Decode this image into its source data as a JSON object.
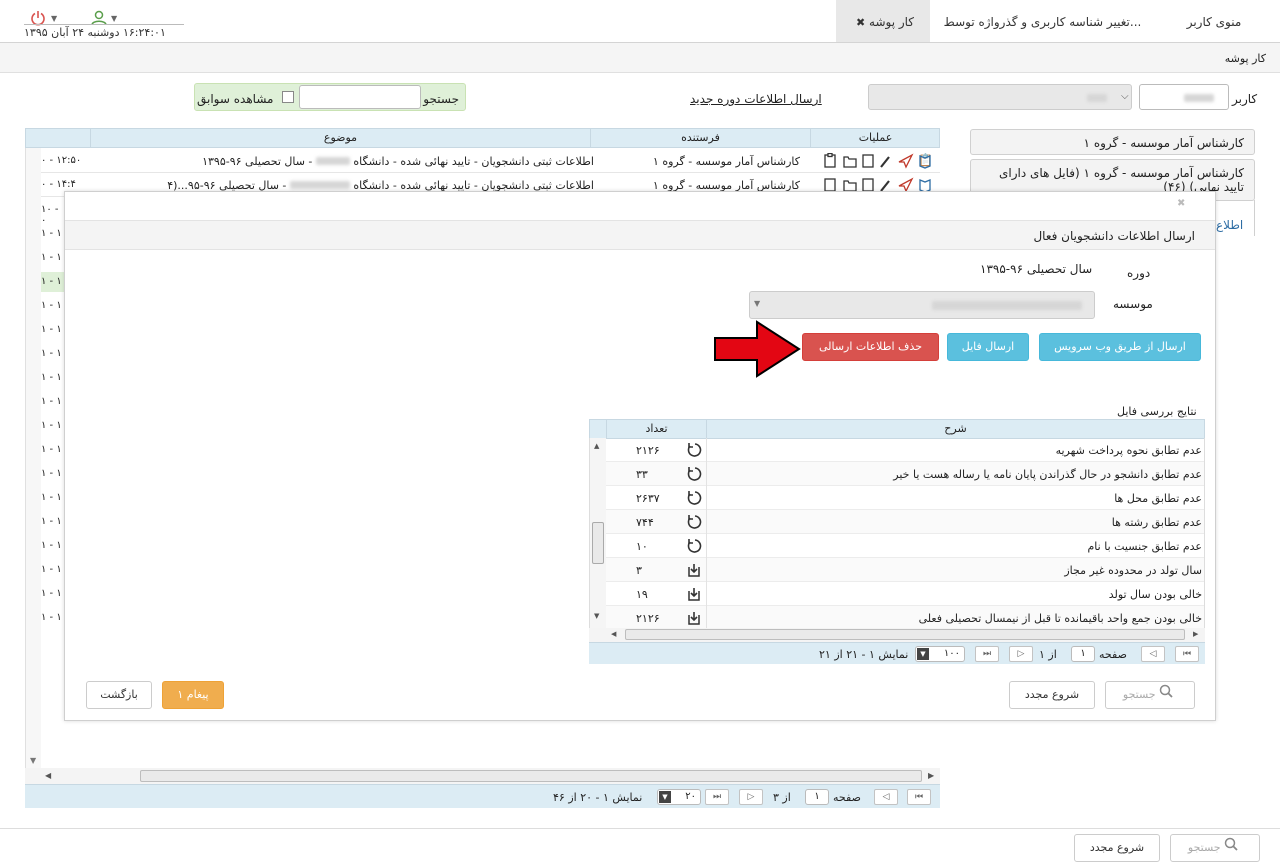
{
  "topbar": {
    "tabs": [
      {
        "label": "کار پوشه",
        "active": true
      },
      {
        "label": "تغییر شناسه کاربری و گذرواژه توسط..."
      },
      {
        "label": "منوی کاربر"
      }
    ],
    "datetime": "۱۶:۲۴:۰۱ دوشنبه ۲۴ آبان ۱۳۹۵"
  },
  "breadcrumb": "کار پوشه",
  "toolbar": {
    "user_label": "کاربر",
    "send_link": "ارسال اطلاعات دوره جدید",
    "search_label": "جستجو",
    "history_label": "مشاهده سوابق"
  },
  "grid": {
    "columns": [
      "عملیات",
      "فرستنده",
      "موضوع"
    ],
    "rows": [
      {
        "sender": "کارشناس آمار موسسه - گروه ۱",
        "subject_start": "اطلاعات ثبتی دانشجویان - تایید نهائی شده - دانشگاه",
        "subject_end": "- سال تحصیلی ۹۶-۱۳۹۵",
        "time": "۱۲:۵۰ - ۰"
      },
      {
        "sender": "کارشناس آمار موسسه - گروه ۱",
        "subject_start": "اطلاعات ثبتی دانشجویان - تایید نهائی شده - دانشگاه",
        "subject_end": "- سال تحصیلی ۹۶-۹۵...(۴",
        "time": "۱۴:۴ - ۰"
      }
    ],
    "left_times": [
      "۱۰ - ۰",
      "۱ - ۱",
      "۱ - ۱",
      "۱ - ۱",
      "۱ - ۱",
      "۱ - ۱",
      "۱ - ۱",
      "۱ - ۱",
      "۱ - ۱",
      "۱ - ۱",
      "۱ - ۱",
      "۱ - ۱",
      "۱ - ۱",
      "۱ - ۱",
      "۱ - ۱",
      "۱ - ۱",
      "۱ - ۱",
      "۱ - ۱",
      "۱ - ۱"
    ],
    "pager": {
      "page_label": "صفحه",
      "page": "۱",
      "of_label": "از ۳",
      "per_page": "۲۰",
      "summary": "نمایش ۱ - ۲۰ از ۴۶"
    }
  },
  "sidebar": {
    "items": [
      "کارشناس آمار موسسه - گروه ۱",
      "کارشناس آمار موسسه - گروه ۱ (فایل های دارای تایید نهایی) (۴۶)",
      "اطلاع"
    ]
  },
  "modal": {
    "title": "ارسال اطلاعات دانشجویان فعال",
    "course_label": "دوره",
    "course_value": "سال تحصیلی ۹۶-۱۳۹۵",
    "institute_label": "موسسه",
    "btn_webservice": "ارسال از طریق وب سرویس",
    "btn_file": "ارسال فایل",
    "btn_delete": "حذف اطلاعات ارسالی",
    "results_title": "نتایج بررسی فایل",
    "results_columns": [
      "شرح",
      "تعداد"
    ],
    "results": [
      {
        "desc": "عدم تطابق نحوه پرداخت شهریه",
        "count": "۲۱۲۶",
        "icon": "undo-icon"
      },
      {
        "desc": "عدم تطابق دانشجو در حال گذراندن پایان نامه یا رساله هست یا خیر",
        "count": "۳۳",
        "icon": "undo-icon"
      },
      {
        "desc": "عدم تطابق محل ها",
        "count": "۲۶۳۷",
        "icon": "undo-icon"
      },
      {
        "desc": "عدم تطابق رشته ها",
        "count": "۷۴۴",
        "icon": "undo-icon"
      },
      {
        "desc": "عدم تطابق جنسیت با نام",
        "count": "۱۰",
        "icon": "undo-icon"
      },
      {
        "desc": "سال تولد در محدوده غیر مجاز",
        "count": "۳",
        "icon": "download-icon"
      },
      {
        "desc": "خالی بودن سال تولد",
        "count": "۱۹",
        "icon": "download-icon"
      },
      {
        "desc": "خالی بودن جمع واحد باقیمانده تا قبل از نیمسال تحصیلی فعلی",
        "count": "۲۱۲۶",
        "icon": "download-icon"
      }
    ],
    "results_pager": {
      "page_label": "صفحه",
      "page": "۱",
      "of_label": "از ۱",
      "per_page": "۱۰۰",
      "summary": "نمایش ۱ - ۲۱ از ۲۱"
    },
    "footer": {
      "search": "جستجو",
      "reset": "شروع مجدد",
      "messages": "۱ پیغام",
      "back": "بازگشت"
    }
  },
  "page_footer": {
    "search": "جستجو",
    "reset": "شروع مجدد"
  }
}
